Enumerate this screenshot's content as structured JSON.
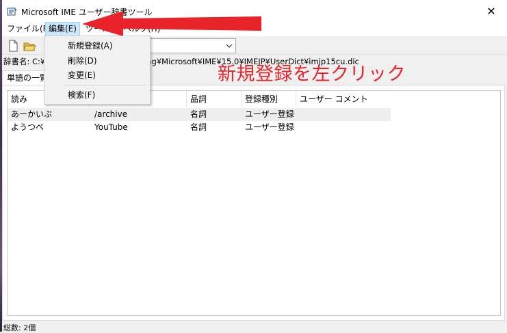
{
  "window": {
    "title": "Microsoft IME ユーザー辞書ツール",
    "close_symbol": "✕"
  },
  "menubar": {
    "items": [
      {
        "label": "ファイル(F)"
      },
      {
        "label": "編集(E)"
      },
      {
        "label": "ツール(T)"
      },
      {
        "label": "ヘルプ(H)"
      }
    ]
  },
  "edit_menu": {
    "items": [
      {
        "label": "新規登録(A)"
      },
      {
        "label": "削除(D)"
      },
      {
        "label": "変更(E)"
      },
      {
        "label": "検索(F)"
      }
    ]
  },
  "path_line": {
    "left": "辞書名: C:¥",
    "right": "ng¥Microsoft¥IME¥15.0¥IMEJP¥UserDict¥imjp15cu.dic"
  },
  "tabs": {
    "word_list": "単語の一覧"
  },
  "list": {
    "columns": [
      "読み",
      "",
      "品詞",
      "登録種別",
      "ユーザー コメント"
    ],
    "rows": [
      {
        "reading": "あーかいぶ",
        "word": "/archive",
        "pos": "名詞",
        "type": "ユーザー登録",
        "comment": ""
      },
      {
        "reading": "ようつべ",
        "word": "YouTube",
        "pos": "名詞",
        "type": "ユーザー登録",
        "comment": ""
      }
    ]
  },
  "status": {
    "text": "総数: 2個"
  },
  "annotation": {
    "text": "新規登録を左クリック",
    "color": "#e8242a"
  },
  "icons": {
    "app": "dictionary-icon",
    "new": "new-document-icon",
    "open": "open-folder-icon",
    "caret": "chevron-down-icon",
    "arrow": "red-arrow-icon"
  }
}
